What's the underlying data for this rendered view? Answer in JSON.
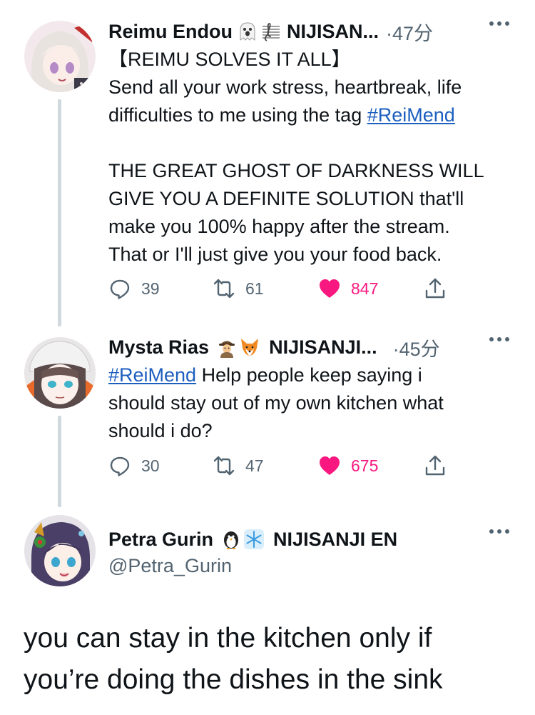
{
  "tweets": [
    {
      "name": "Reimu Endou",
      "emojis": [
        "ghost-emoji",
        "music-staff-emoji"
      ],
      "affiliation": "NIJISAN...",
      "time": "·47分",
      "lines": [
        "【REIMU SOLVES IT ALL】",
        "Send all your work stress, heartbreak, life",
        "difficulties to me using the tag ",
        "#ReiMend",
        "",
        "THE GREAT GHOST OF DARKNESS WILL",
        "GIVE YOU A DEFINITE SOLUTION that'll",
        "make you 100% happy after the stream.",
        "That or I'll just give you your food back."
      ],
      "replies": "39",
      "retweets": "61",
      "likes": "847"
    },
    {
      "name": "Mysta Rias",
      "emojis": [
        "detective-emoji",
        "fox-emoji"
      ],
      "affiliation": "NIJISANJI...",
      "time": "·45分",
      "hashtag": "#ReiMend",
      "line1_rest": " Help people keep saying i",
      "line2": "should stay out of my own kitchen what",
      "line3": "should i do?",
      "replies": "30",
      "retweets": "47",
      "likes": "675"
    },
    {
      "name": "Petra Gurin",
      "emojis": [
        "penguin-emoji",
        "snowflake-emoji"
      ],
      "affiliation": "NIJISANJI EN",
      "handle": "@Petra_Gurin",
      "text_line1": "you can stay in the kitchen only if",
      "text_line2": "you’re doing the dishes in the sink"
    }
  ],
  "colors": {
    "text": "#0f1419",
    "secondary": "#536471",
    "link": "#1d5fbf",
    "like": "#f91880",
    "thread_line": "#cfd9de"
  }
}
